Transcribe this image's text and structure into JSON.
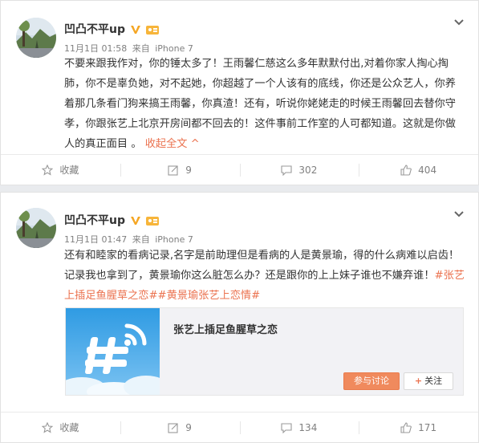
{
  "posts": [
    {
      "author": "凹凸不平up",
      "time": "11月1日 01:58",
      "source_prefix": "来自",
      "source": "iPhone 7",
      "text": "不要来跟我作对，你的锤太多了！王雨馨仁慈这么多年默默付出,对着你家人掏心掏肺，你不是辜负她，对不起她，你超越了一个人该有的底线，你还是公众艺人，你养着那几条看门狗来搞王雨馨，你真渣！还有，听说你姥姥走的时候王雨馨回去替你守孝，你跟张艺上北京开房间都不回去的！这件事前工作室的人可都知道。这就是你做人的真正面目 。",
      "collapse_label": "收起全文",
      "collapse_arrow": "^",
      "actions": {
        "favorite": "收藏",
        "repost": "9",
        "comment": "302",
        "like": "404"
      }
    },
    {
      "author": "凹凸不平up",
      "time": "11月1日 01:47",
      "source_prefix": "来自",
      "source": "iPhone 7",
      "text": "还有和睦家的看病记录,名字是前助理但是看病的人是黄景瑜，得的什么病难以启齿！记录我也拿到了，黄景瑜你这么脏怎么办？还是跟你的上上妹子谁也不嫌弃谁！",
      "hashtags": "#张艺上插足鱼腥草之恋##黄景瑜张艺上恋情#",
      "topic_card": {
        "title": "张艺上插足鱼腥草之恋",
        "join_label": "参与讨论",
        "follow_plus": "+",
        "follow_label": "关注"
      },
      "actions": {
        "favorite": "收藏",
        "repost": "9",
        "comment": "134",
        "like": "171"
      }
    }
  ],
  "colors": {
    "accent": "#eb7350",
    "meta": "#808080",
    "text": "#333333",
    "background": "#e9ebee"
  },
  "icons": [
    "chevron-down-icon",
    "verified-v-icon",
    "level-badge-icon",
    "star-icon",
    "repost-icon",
    "comment-icon",
    "like-icon",
    "topic-hash-icon"
  ]
}
